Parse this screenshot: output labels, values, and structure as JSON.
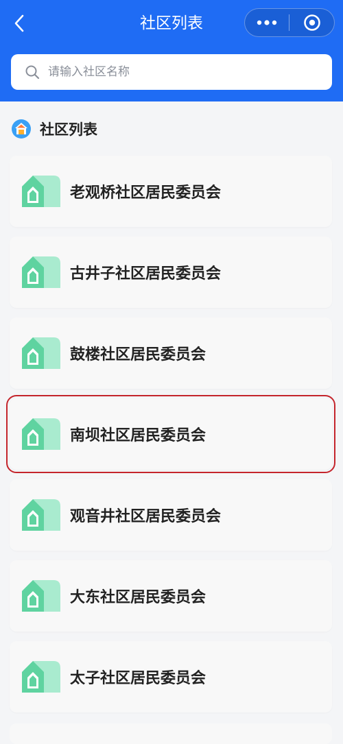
{
  "header": {
    "title": "社区列表",
    "back_icon": "chevron-left-icon",
    "more_icon": "more-dots-icon",
    "close_icon": "target-circle-icon"
  },
  "search": {
    "placeholder": "请输入社区名称",
    "icon": "search-icon"
  },
  "section": {
    "title": "社区列表",
    "icon": "community-house-icon"
  },
  "communities": [
    {
      "name": "老观桥社区居民委员会",
      "highlighted": false
    },
    {
      "name": "古井子社区居民委员会",
      "highlighted": false
    },
    {
      "name": "鼓楼社区居民委员会",
      "highlighted": false
    },
    {
      "name": "南坝社区居民委员会",
      "highlighted": true
    },
    {
      "name": "观音井社区居民委员会",
      "highlighted": false
    },
    {
      "name": "大东社区居民委员会",
      "highlighted": false
    },
    {
      "name": "太子社区居民委员会",
      "highlighted": false
    }
  ],
  "colors": {
    "header_bg": "#1f6cf4",
    "highlight_border": "#c4242b",
    "icon_green": "#5fd3a0"
  }
}
